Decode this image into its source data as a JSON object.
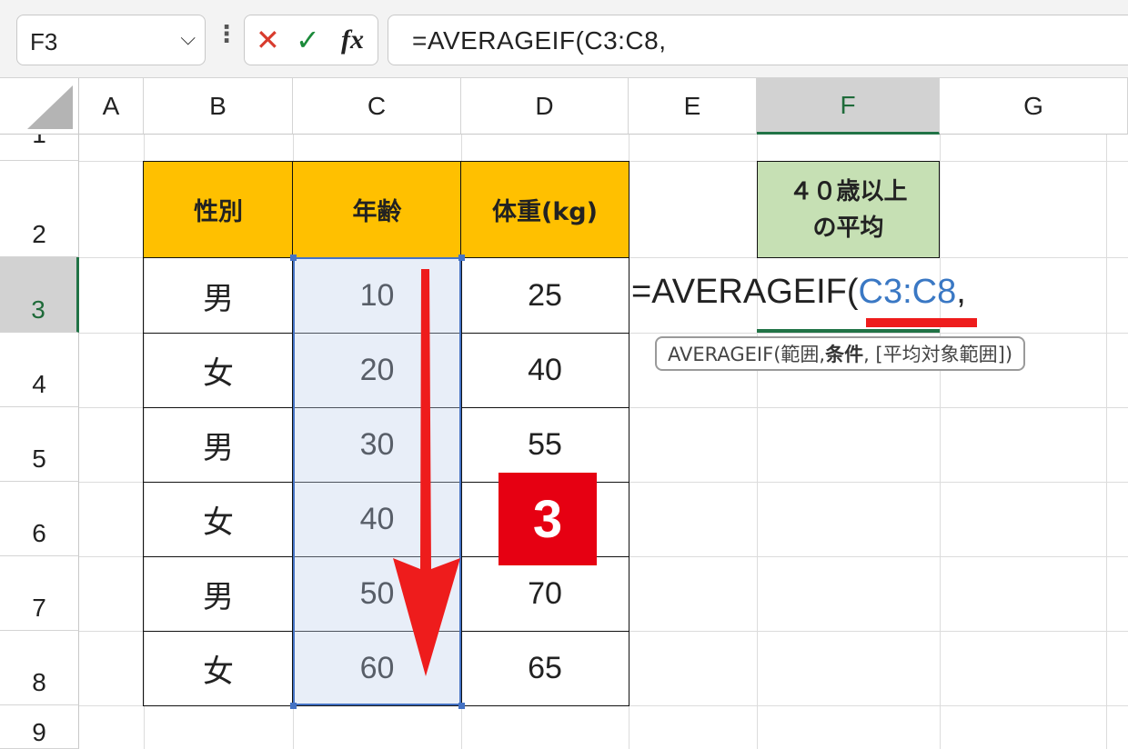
{
  "formula_bar": {
    "name_box": "F3",
    "name_box_chevron": "⌵",
    "more_dots": "⋮",
    "cancel_glyph": "✕",
    "enter_glyph": "✓",
    "fx_label": "fx",
    "formula": "=AVERAGEIF(C3:C8,"
  },
  "columns": [
    "A",
    "B",
    "C",
    "D",
    "E",
    "F",
    "G"
  ],
  "rows": [
    "1",
    "2",
    "3",
    "4",
    "5",
    "6",
    "7",
    "8",
    "9"
  ],
  "table": {
    "headers": [
      "性別",
      "年齢",
      "体重(kg)"
    ],
    "rows": [
      [
        "男",
        "10",
        "25"
      ],
      [
        "女",
        "20",
        "40"
      ],
      [
        "男",
        "30",
        "55"
      ],
      [
        "女",
        "40",
        ""
      ],
      [
        "男",
        "50",
        "70"
      ],
      [
        "女",
        "60",
        "65"
      ]
    ]
  },
  "f2_header": {
    "line1": "４０歳以上",
    "line2": "の平均"
  },
  "cell_edit": {
    "prefix": "=AVERAGEIF(",
    "ref": "C3:C8",
    "suffix": ","
  },
  "tooltip": {
    "fn": "AVERAGEIF(範囲, ",
    "bold_arg": "条件",
    "rest": ", [平均対象範囲])"
  },
  "badge": "3",
  "colors": {
    "header_fill": "#ffc000",
    "green_fill": "#c6e0b4",
    "accent_red": "#e60012",
    "selection_blue": "#4472c4"
  }
}
